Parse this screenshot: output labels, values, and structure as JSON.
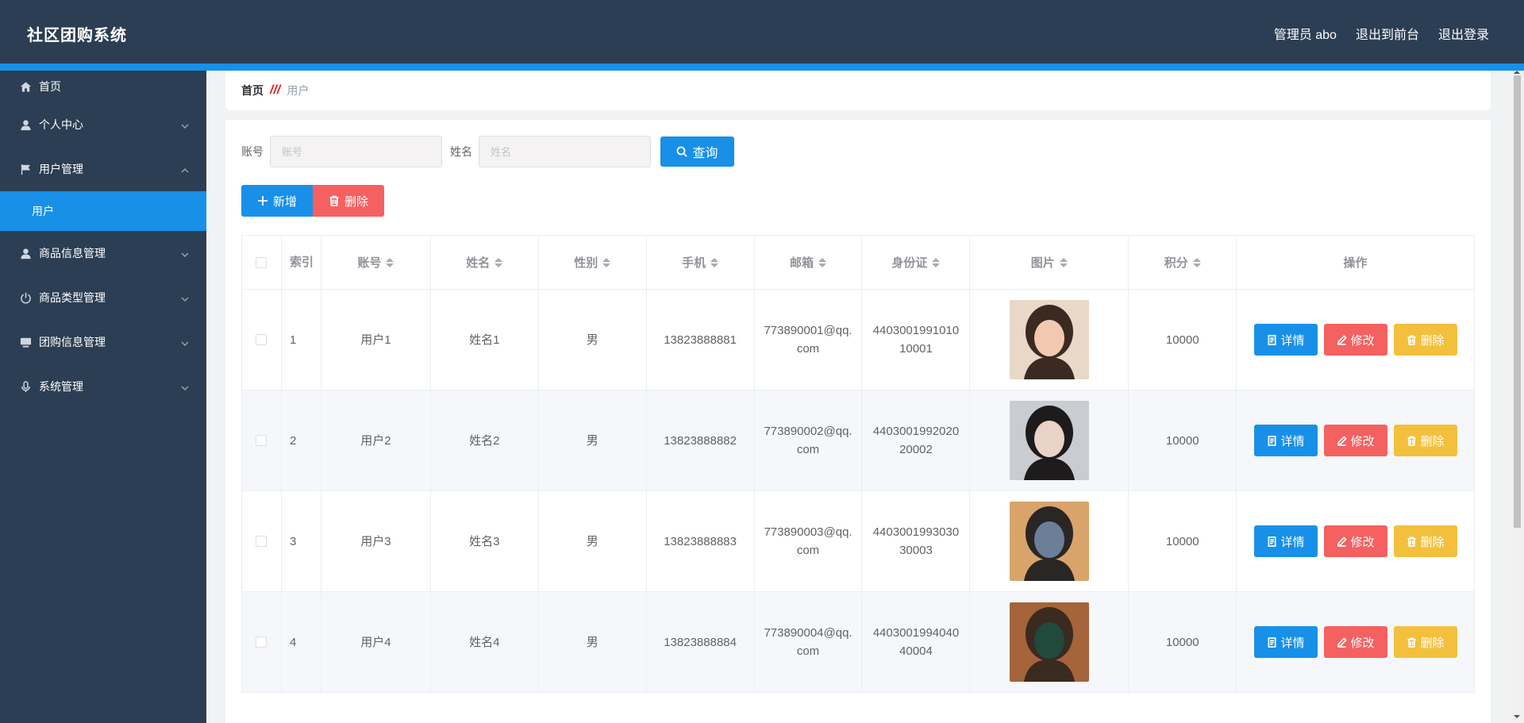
{
  "app": {
    "title": "社区团购系统"
  },
  "header": {
    "admin": "管理员 abo",
    "to_front": "退出到前台",
    "logout": "退出登录"
  },
  "sidebar": {
    "items": [
      {
        "label": "首页",
        "icon": "home-icon",
        "expandable": false
      },
      {
        "label": "个人中心",
        "icon": "user-icon",
        "expandable": true,
        "expanded": false
      },
      {
        "label": "用户管理",
        "icon": "flag-icon",
        "expandable": true,
        "expanded": true
      },
      {
        "label": "商品信息管理",
        "icon": "user-icon",
        "expandable": true,
        "expanded": false
      },
      {
        "label": "商品类型管理",
        "icon": "power-icon",
        "expandable": true,
        "expanded": false
      },
      {
        "label": "团购信息管理",
        "icon": "monitor-icon",
        "expandable": true,
        "expanded": false
      },
      {
        "label": "系统管理",
        "icon": "mic-icon",
        "expandable": true,
        "expanded": false
      }
    ],
    "active_sub": "用户"
  },
  "breadcrumb": {
    "home": "首页",
    "separator": "///",
    "current": "用户"
  },
  "search": {
    "account_label": "账号",
    "account_placeholder": "账号",
    "name_label": "姓名",
    "name_placeholder": "姓名",
    "query_button": "查询"
  },
  "actions": {
    "add": "新增",
    "delete": "删除"
  },
  "table": {
    "headers": {
      "index": "索引",
      "account": "账号",
      "name": "姓名",
      "sex": "性别",
      "phone": "手机",
      "email": "邮箱",
      "id_card": "身份证",
      "image": "图片",
      "score": "积分",
      "ops": "操作"
    },
    "op_labels": {
      "detail": "详情",
      "edit": "修改",
      "delete": "删除"
    },
    "rows": [
      {
        "index": "1",
        "account": "用户1",
        "name": "姓名1",
        "sex": "男",
        "phone": "13823888881",
        "email": "773890001@qq.com",
        "id_card": "440300199101010001",
        "score": "10000"
      },
      {
        "index": "2",
        "account": "用户2",
        "name": "姓名2",
        "sex": "男",
        "phone": "13823888882",
        "email": "773890002@qq.com",
        "id_card": "440300199202020002",
        "score": "10000"
      },
      {
        "index": "3",
        "account": "用户3",
        "name": "姓名3",
        "sex": "男",
        "phone": "13823888883",
        "email": "773890003@qq.com",
        "id_card": "440300199303030003",
        "score": "10000"
      },
      {
        "index": "4",
        "account": "用户4",
        "name": "姓名4",
        "sex": "男",
        "phone": "13823888884",
        "email": "773890004@qq.com",
        "id_card": "440300199404040004",
        "score": "10000"
      }
    ]
  },
  "colors": {
    "header_bg": "#2c3e53",
    "accent": "#1890e8",
    "danger": "#f56060",
    "warning": "#f3c03e"
  }
}
